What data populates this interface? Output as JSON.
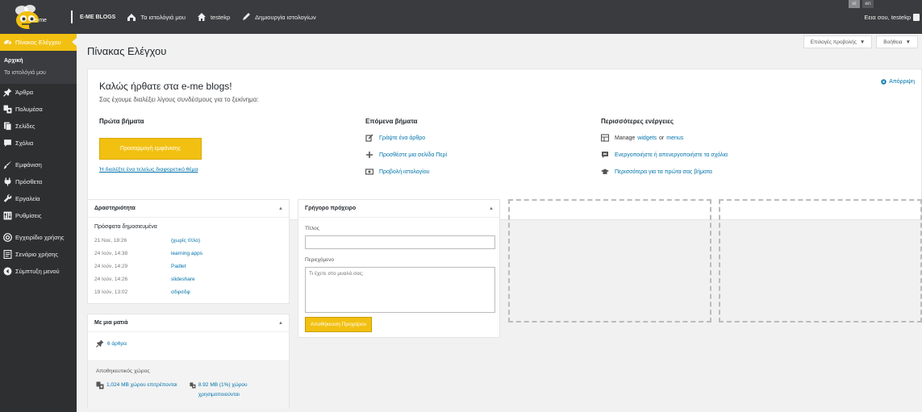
{
  "adminbar": {
    "brand": "E-ME BLOGS",
    "logo_text": "e-me",
    "my_blogs": "Τα ιστολόγιά μου",
    "site": "testekp",
    "create_blog": "Δημιουργία ιστολογίων",
    "languages": [
      "el",
      "en"
    ],
    "greeting": "Εεια σου, testekp"
  },
  "sidebar": {
    "dashboard": "Πίνακας Ελέγχου",
    "sub": [
      "Αρχική",
      "Τα ιστολόγιά μου"
    ],
    "items1": [
      {
        "label": "Άρθρα",
        "icon": "pin-icon"
      },
      {
        "label": "Πολυμέσα",
        "icon": "media-icon"
      },
      {
        "label": "Σελίδες",
        "icon": "pages-icon"
      },
      {
        "label": "Σχόλια",
        "icon": "comments-icon"
      }
    ],
    "items2": [
      {
        "label": "Εμφάνιση",
        "icon": "brush-icon"
      },
      {
        "label": "Πρόσθετα",
        "icon": "plugin-icon"
      },
      {
        "label": "Εργαλεία",
        "icon": "wrench-icon"
      },
      {
        "label": "Ρυθμίσεις",
        "icon": "settings-icon"
      }
    ],
    "items3": [
      {
        "label": "Εγχειρίδιο χρήσης",
        "icon": "help-icon"
      },
      {
        "label": "Σενάριο χρήσης",
        "icon": "doc-icon"
      },
      {
        "label": "Σύμπτυξη μενού",
        "icon": "collapse-icon"
      }
    ]
  },
  "screen_options": "Επιλογές προβολής",
  "help": "Βοήθεια",
  "page_title": "Πίνακας Ελέγχου",
  "welcome": {
    "title": "Καλώς ήρθατε στα e-me blogs!",
    "about": "Σας έχουμε διαλέξει λίγους συνδέσμους για το ξεκίνημα:",
    "dismiss": "Απόρριψη",
    "col1": {
      "heading": "Πρώτα βήματα",
      "button": "Προσαρμογή εμφάνισης",
      "alt": "Ή διαλέξτε ένα τελείως διαφορετικό θέμα"
    },
    "col2": {
      "heading": "Επόμενα βήματα",
      "links": [
        "Γράψτε ένα άρθρο",
        "Προσθέστε μια σελίδα Περί",
        "Προβολή ιστολογίου"
      ]
    },
    "col3": {
      "heading": "Περισσότερες ενέργειες",
      "manage_prefix": "Manage",
      "widgets": "widgets",
      "or": "or",
      "menus": "menus",
      "comments": "Ενεργοποιήστε ή απενεργοποιήστε τα σχόλια",
      "learn": "Περισσότερα για τα πρώτα σας βήματα"
    }
  },
  "activity": {
    "title": "Δραστηριότητα",
    "recent": "Πρόσφατα δημοσιευμένα",
    "items": [
      {
        "date": "21 Νοε, 18:26",
        "title": "(χωρίς τίτλο)"
      },
      {
        "date": "24 Ιούν, 14:38",
        "title": "learning apps"
      },
      {
        "date": "24 Ιούν, 14:29",
        "title": "Padlet"
      },
      {
        "date": "24 Ιούν, 14:26",
        "title": "slideshare"
      },
      {
        "date": "19 Ιούν, 13:02",
        "title": "σδφσδφ"
      }
    ]
  },
  "draft": {
    "title": "Γρήγορο πρόχειρο",
    "title_label": "Τίτλος",
    "content_label": "Περιεχόμενο",
    "content_placeholder": "Τι έχετε στο μυαλό σας;",
    "save": "Αποθήκευση Προχείρου"
  },
  "glance": {
    "title": "Με μια ματιά",
    "posts": "6 άρθρα",
    "storage_title": "Αποθηκευτικός χώρος",
    "allowed": "1,024 MB χώρου επιτρέπονται",
    "used": "8.92 MB (1%) χώρου χρησιμοποιούνται"
  },
  "colors": {
    "accent": "#f2c011",
    "bar": "#3a3b3e",
    "sidebar": "#2e2f31",
    "link": "#0073aa"
  }
}
